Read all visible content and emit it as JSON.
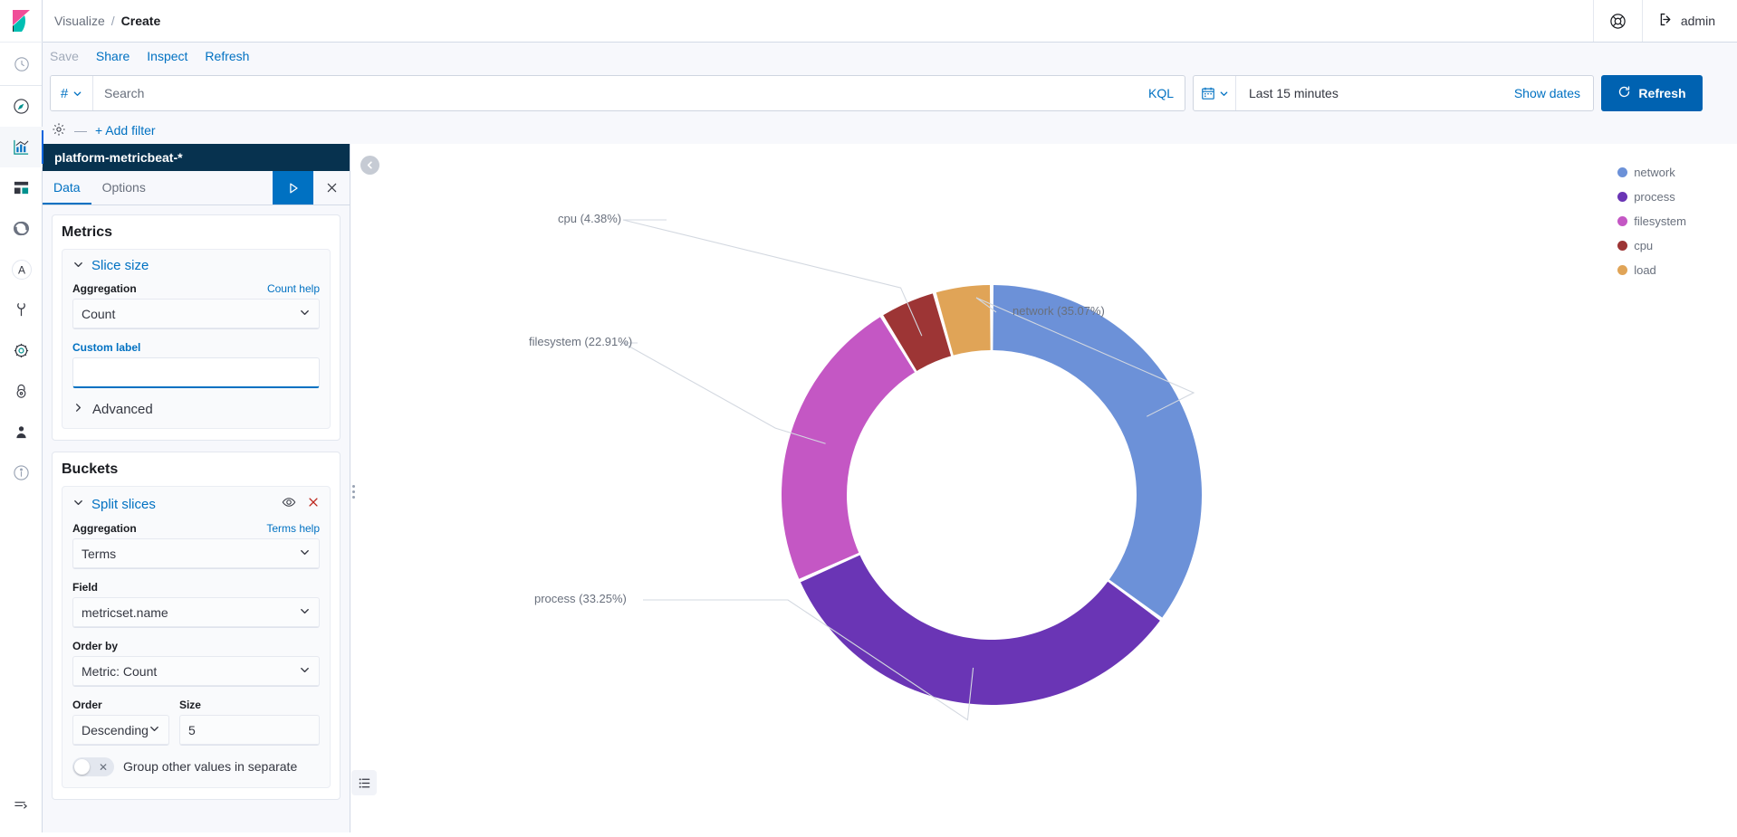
{
  "header": {
    "breadcrumb": {
      "parent": "Visualize",
      "separator": "/",
      "current": "Create"
    },
    "help_icon": "help-lifebuoy-icon",
    "user": {
      "label": "admin",
      "icon": "logout-icon"
    }
  },
  "toolbar": {
    "save_label": "Save",
    "share_label": "Share",
    "inspect_label": "Inspect",
    "refresh_label": "Refresh"
  },
  "query_bar": {
    "prefix_icon": "number-field-icon",
    "prefix_symbol": "#",
    "search_value": "",
    "search_placeholder": "Search",
    "language_label": "KQL",
    "calendar_icon": "calendar-icon",
    "date_range": "Last 15 minutes",
    "show_dates_label": "Show dates",
    "refresh_button_label": "Refresh"
  },
  "filter_bar": {
    "settings_icon": "gear-icon",
    "dash": "—",
    "add_filter_label": "+ Add filter"
  },
  "editor": {
    "index_pattern": "platform-metricbeat-*",
    "tabs": [
      {
        "label": "Data",
        "selected": true
      },
      {
        "label": "Options",
        "selected": false
      }
    ],
    "apply_icon": "play-apply-icon",
    "discard_icon": "close-x-icon",
    "metrics": {
      "title": "Metrics",
      "agg_name": "Slice size",
      "aggregation_label": "Aggregation",
      "aggregation_help": "Count help",
      "aggregation_value": "Count",
      "custom_label_label": "Custom label",
      "custom_label_value": "",
      "advanced_label": "Advanced"
    },
    "buckets": {
      "title": "Buckets",
      "agg_name": "Split slices",
      "toggle_icon": "eye-icon",
      "remove_icon": "close-x-icon",
      "aggregation_label": "Aggregation",
      "aggregation_help": "Terms help",
      "aggregation_value": "Terms",
      "field_label": "Field",
      "field_value": "metricset.name",
      "order_by_label": "Order by",
      "order_by_value": "Metric: Count",
      "order_label": "Order",
      "order_value": "Descending",
      "size_label": "Size",
      "size_value": "5",
      "group_other_label": "Group other values in separate"
    }
  },
  "left_rail": {
    "logo": "kibana-logo",
    "items": [
      {
        "name": "recently-viewed-icon",
        "active": false
      },
      {
        "name": "discover-compass-icon",
        "active": false
      },
      {
        "name": "visualize-chart-icon",
        "active": true
      },
      {
        "name": "dashboard-icon",
        "active": false
      },
      {
        "name": "dev-tools-loop-icon",
        "active": false
      },
      {
        "name": "apm-letter-a-icon",
        "active": false
      },
      {
        "name": "wrench-icon",
        "active": false
      },
      {
        "name": "gear-icon",
        "active": false
      },
      {
        "name": "lock-security-icon",
        "active": false
      },
      {
        "name": "user-icon",
        "active": false
      },
      {
        "name": "info-icon",
        "active": false
      }
    ],
    "collapse_icon": "collapse-nav-icon"
  },
  "visualization": {
    "collapse_panel_icon": "chevron-left-circle-icon",
    "drag_handle_icon": "drag-handle-icon",
    "legend_toggle_icon": "legend-list-icon"
  },
  "chart_data": {
    "type": "pie",
    "variant": "donut",
    "title": "",
    "legend_position": "right",
    "categories": [
      "network",
      "process",
      "filesystem",
      "cpu",
      "load"
    ],
    "values": [
      35.07,
      33.25,
      22.91,
      4.38,
      4.39
    ],
    "value_unit": "%",
    "colors": [
      "#6c91d8",
      "#6a35b5",
      "#c martin",
      "#9d3535",
      "#e0a457"
    ],
    "slice_colors": [
      "#6c91d8",
      "#6a35b5",
      "#c457c4",
      "#9d3535",
      "#e0a457"
    ],
    "slices": [
      {
        "label": "network",
        "percent": 35.07,
        "display": "network (35.07%)",
        "color": "#6c91d8",
        "labeled": true
      },
      {
        "label": "process",
        "percent": 33.25,
        "display": "process (33.25%)",
        "color": "#6a35b5",
        "labeled": true
      },
      {
        "label": "filesystem",
        "percent": 22.91,
        "display": "filesystem (22.91%)",
        "color": "#c457c4",
        "labeled": true
      },
      {
        "label": "cpu",
        "percent": 4.38,
        "display": "cpu (4.38%)",
        "color": "#9d3535",
        "labeled": true
      },
      {
        "label": "load",
        "percent": 4.39,
        "display": "",
        "color": "#e0a457",
        "labeled": false
      }
    ],
    "legend": [
      {
        "label": "network",
        "color": "#6c91d8"
      },
      {
        "label": "process",
        "color": "#6a35b5"
      },
      {
        "label": "filesystem",
        "color": "#c457c4"
      },
      {
        "label": "cpu",
        "color": "#9d3535"
      },
      {
        "label": "load",
        "color": "#e0a457"
      }
    ]
  }
}
